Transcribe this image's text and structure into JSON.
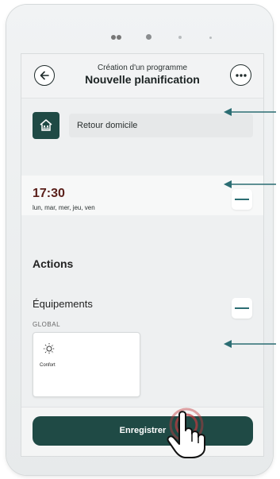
{
  "header": {
    "subtitle": "Création d'un programme",
    "title": "Nouvelle planification",
    "back_icon": "arrow-left-icon",
    "more_icon": "more-horizontal-icon"
  },
  "scene": {
    "icon": "home-icon",
    "label": "Retour domicile"
  },
  "schedule": {
    "time": "17:30",
    "days": "lun, mar, mer, jeu, ven"
  },
  "actions": {
    "title": "Actions",
    "equipements_title": "Équipements",
    "global_label": "GLOBAL",
    "devices": [
      {
        "label": "Confort",
        "icon": "sun-icon"
      }
    ]
  },
  "footer": {
    "save_label": "Enregistrer"
  },
  "colors": {
    "accent": "#1f4a45",
    "time": "#5a1f1a",
    "arrow": "#2b6d73",
    "tap": "#c0393f"
  }
}
